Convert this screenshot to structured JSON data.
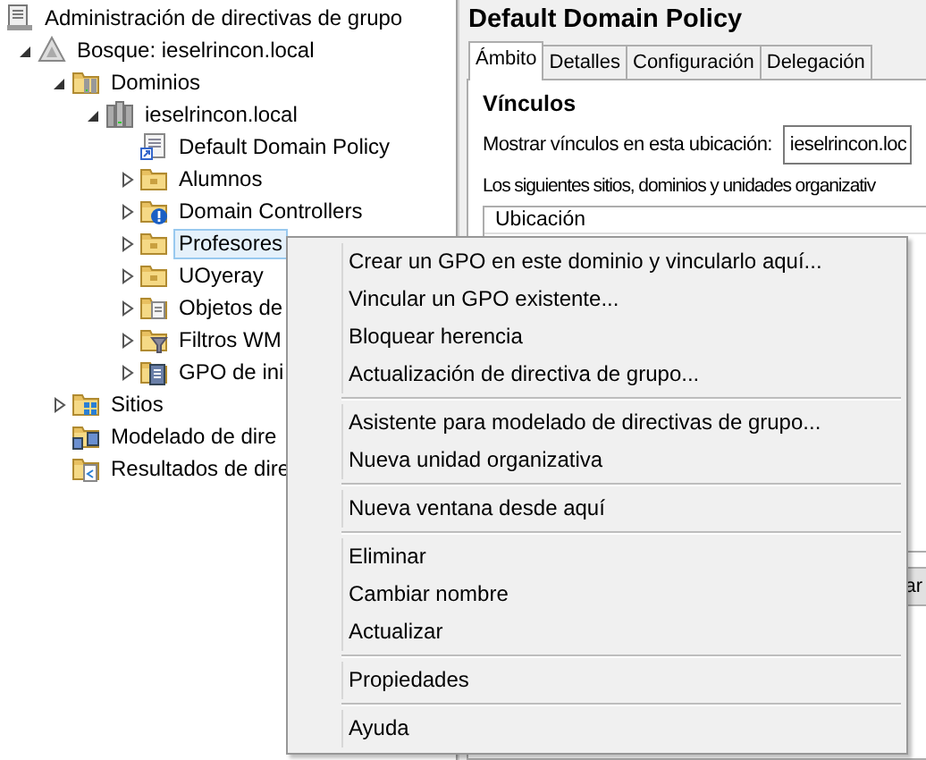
{
  "tree": [
    {
      "label": "Administración de directivas de grupo",
      "kind": "console",
      "selected": false,
      "children": [
        {
          "label": "Bosque: ieselrincon.local",
          "kind": "forest",
          "selected": false,
          "expanded": true,
          "children": [
            {
              "label": "Dominios",
              "kind": "domains",
              "selected": false,
              "expanded": true,
              "children": [
                {
                  "label": "ieselrincon.local",
                  "kind": "domain",
                  "selected": false,
                  "expanded": true,
                  "children": [
                    {
                      "label": "Default Domain Policy",
                      "kind": "gpo-link",
                      "selected": false
                    },
                    {
                      "label": "Alumnos",
                      "kind": "ou",
                      "selected": false,
                      "expanded": false
                    },
                    {
                      "label": "Domain Controllers",
                      "kind": "ou-warning",
                      "selected": false,
                      "expanded": false
                    },
                    {
                      "label": "Profesores",
                      "kind": "ou",
                      "selected": true,
                      "expanded": false
                    },
                    {
                      "label": "UOyeray",
                      "kind": "ou",
                      "selected": false,
                      "expanded": false
                    },
                    {
                      "label": "Objetos de",
                      "kind": "gpo-folder",
                      "selected": false,
                      "expanded": false
                    },
                    {
                      "label": "Filtros WM",
                      "kind": "filter-folder",
                      "selected": false,
                      "expanded": false
                    },
                    {
                      "label": "GPO de ini",
                      "kind": "starter-folder",
                      "selected": false,
                      "expanded": false
                    }
                  ]
                }
              ]
            },
            {
              "label": "Sitios",
              "kind": "sites",
              "selected": false,
              "expanded": false
            },
            {
              "label": "Modelado de dire",
              "kind": "modeling",
              "selected": false
            },
            {
              "label": "Resultados de dire",
              "kind": "results",
              "selected": false
            }
          ]
        }
      ]
    }
  ],
  "details": {
    "title": "Default Domain Policy",
    "tabs": [
      {
        "label": "Ámbito",
        "selected": true
      },
      {
        "label": "Detalles",
        "selected": false
      },
      {
        "label": "Configuración",
        "selected": false
      },
      {
        "label": "Delegación",
        "selected": false
      }
    ],
    "section_title": "Vínculos",
    "location_label": "Mostrar vínculos en esta ubicación:",
    "location_value": "ieselrincon.loc",
    "description": "Los siguientes sitios, dominios y unidades organizativ",
    "column_header": "Ubicación",
    "button_fragment": "ar"
  },
  "context_menu": {
    "groups": [
      {
        "items": [
          "Crear un GPO en este dominio y vincularlo aquí...",
          "Vincular un GPO existente...",
          "Bloquear herencia",
          "Actualización de directiva de grupo..."
        ]
      },
      {
        "items": [
          "Asistente para modelado de directivas de grupo...",
          "Nueva unidad organizativa"
        ]
      },
      {
        "items": [
          "Nueva ventana desde aquí"
        ]
      },
      {
        "items": [
          "Eliminar",
          "Cambiar nombre",
          "Actualizar"
        ]
      },
      {
        "items": [
          "Propiedades"
        ]
      },
      {
        "items": [
          "Ayuda"
        ]
      }
    ]
  }
}
